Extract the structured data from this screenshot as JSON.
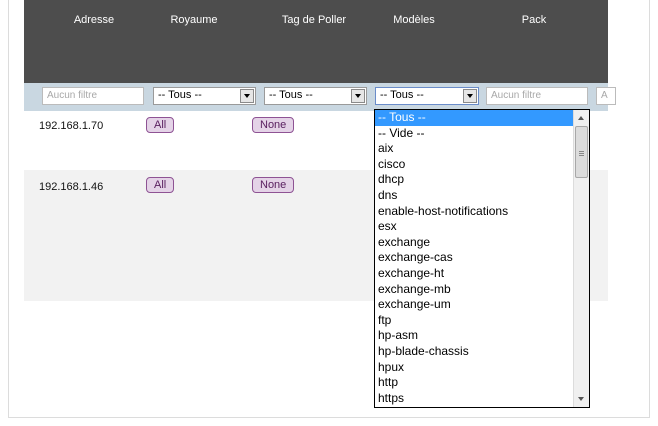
{
  "table": {
    "columns": [
      "Adresse",
      "Royaume",
      "Tag de Poller",
      "Modèles",
      "Pack"
    ],
    "filters": {
      "adresse_placeholder": "Aucun filtre",
      "royaume_value": "-- Tous --",
      "poller_value": "-- Tous --",
      "modeles_value": "-- Tous --",
      "pack_placeholder": "Aucun filtre",
      "extra_placeholder": "A"
    },
    "rows": [
      {
        "address": "192.168.1.70",
        "realm": "All",
        "poller_tag": "None"
      },
      {
        "address": "192.168.1.46",
        "realm": "All",
        "poller_tag": "None"
      }
    ]
  },
  "dropdown": {
    "selected": "-- Tous --",
    "options": [
      "-- Tous --",
      "-- Vide --",
      "aix",
      "cisco",
      "dhcp",
      "dns",
      "enable-host-notifications",
      "esx",
      "exchange",
      "exchange-cas",
      "exchange-ht",
      "exchange-mb",
      "exchange-um",
      "ftp",
      "hp-asm",
      "hp-blade-chassis",
      "hpux",
      "http",
      "https"
    ]
  },
  "colors": {
    "header_bg": "#4d4d4d",
    "filter_bg": "#c9d7e1",
    "badge_bg": "#e4d3e7",
    "badge_border": "#8e5394",
    "selected_option": "#3399ff"
  }
}
